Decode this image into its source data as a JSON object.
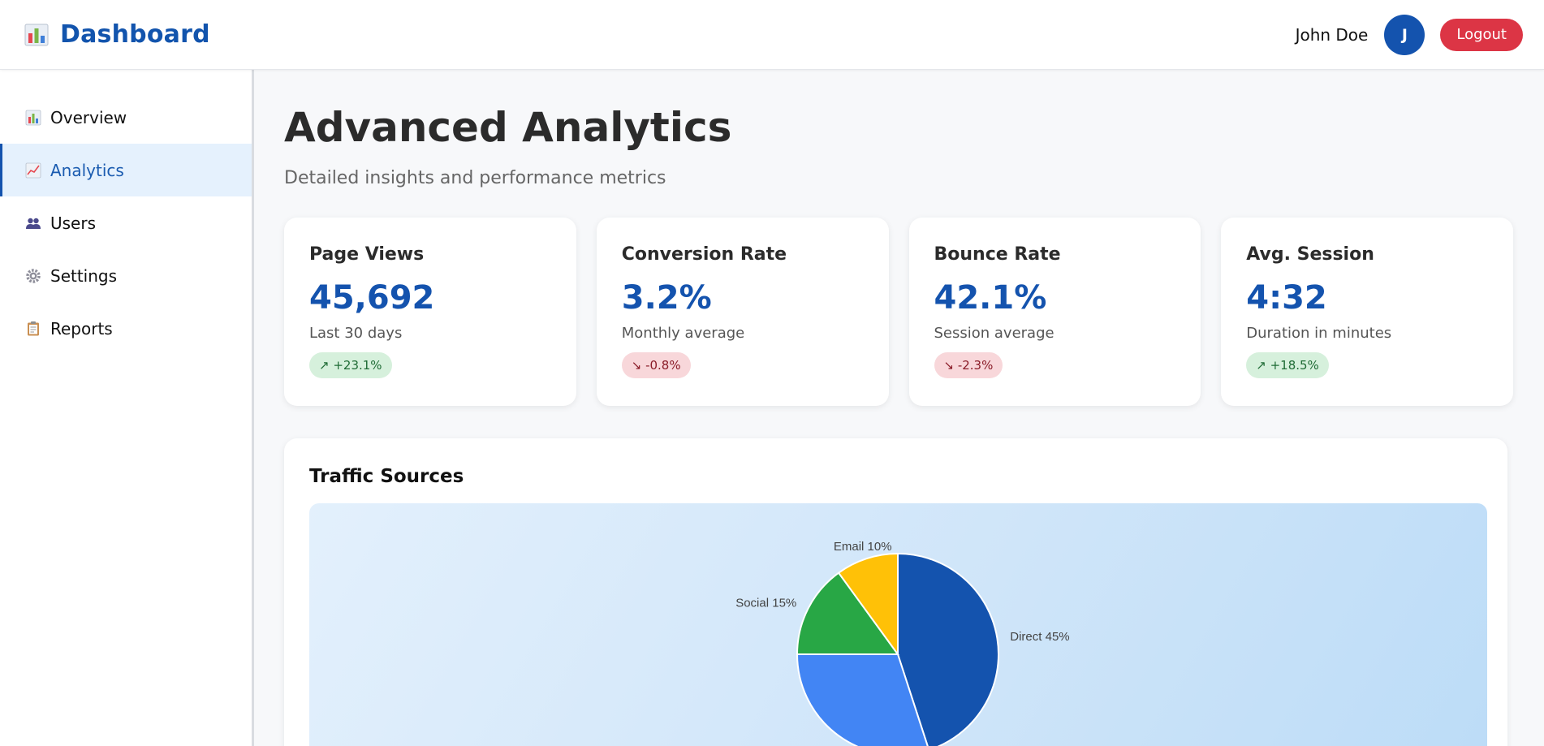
{
  "header": {
    "brand": "Dashboard",
    "user_name": "John Doe",
    "avatar_initial": "J",
    "logout_label": "Logout"
  },
  "sidebar": {
    "items": [
      {
        "label": "Overview",
        "icon": "bar-chart-icon"
      },
      {
        "label": "Analytics",
        "icon": "line-chart-icon",
        "active": true
      },
      {
        "label": "Users",
        "icon": "users-icon"
      },
      {
        "label": "Settings",
        "icon": "gear-icon"
      },
      {
        "label": "Reports",
        "icon": "clipboard-icon"
      }
    ]
  },
  "main": {
    "title": "Advanced Analytics",
    "subtitle": "Detailed insights and performance metrics",
    "cards": [
      {
        "title": "Page Views",
        "value": "45,692",
        "note": "Last 30 days",
        "badge": "↗ +23.1%",
        "trend": "up"
      },
      {
        "title": "Conversion Rate",
        "value": "3.2%",
        "note": "Monthly average",
        "badge": "↘ -0.8%",
        "trend": "down"
      },
      {
        "title": "Bounce Rate",
        "value": "42.1%",
        "note": "Session average",
        "badge": "↘ -2.3%",
        "trend": "down"
      },
      {
        "title": "Avg. Session",
        "value": "4:32",
        "note": "Duration in minutes",
        "badge": "↗ +18.5%",
        "trend": "up"
      }
    ],
    "panel_title": "Traffic Sources"
  },
  "colors": {
    "accent": "#1453ae",
    "danger": "#dc3545",
    "positive_bg": "#d6f0dc",
    "negative_bg": "#f8d7da"
  },
  "chart_data": {
    "type": "pie",
    "title": "Traffic Sources",
    "series": [
      {
        "label": "Direct 45%",
        "value": 45,
        "color": "#1453ae"
      },
      {
        "label": "",
        "value": 30,
        "color": "#4285f4"
      },
      {
        "label": "Social 15%",
        "value": 15,
        "color": "#28a745"
      },
      {
        "label": "Email 10%",
        "value": 10,
        "color": "#ffc107"
      }
    ]
  }
}
